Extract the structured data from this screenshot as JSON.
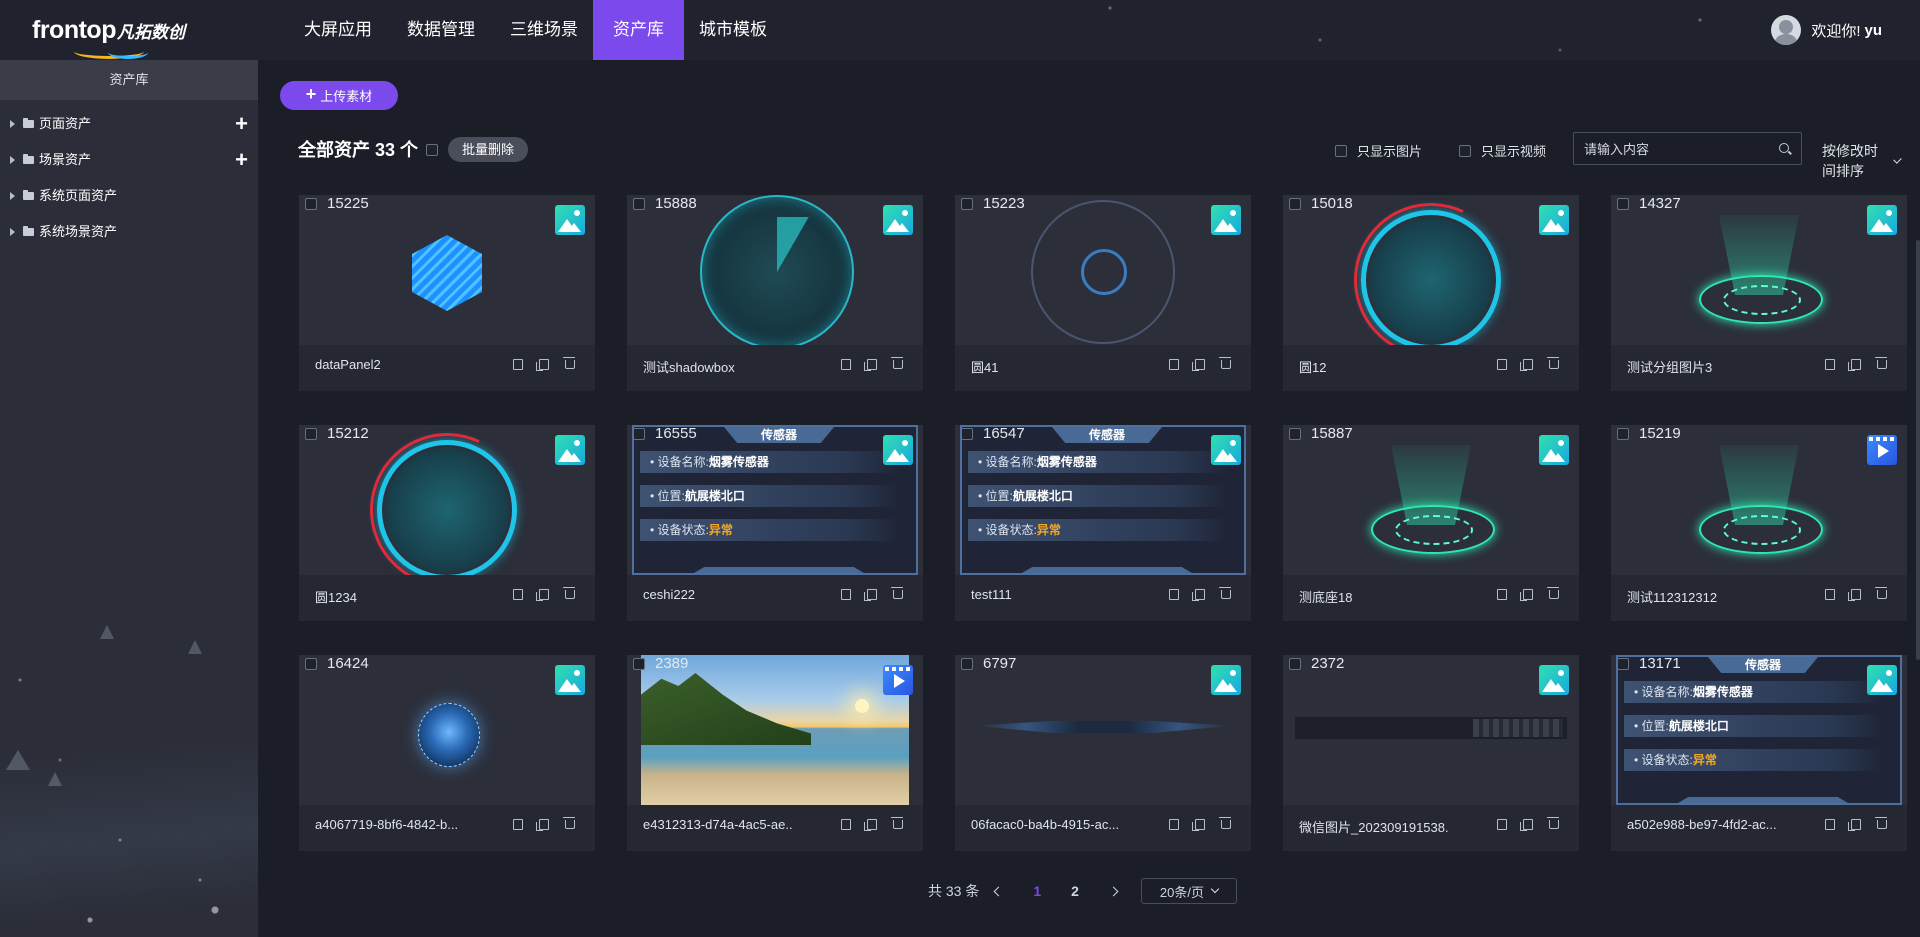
{
  "brand": {
    "name_en": "frontop",
    "name_cn": "凡拓数创"
  },
  "nav": {
    "items": [
      {
        "label": "大屏应用",
        "active": false
      },
      {
        "label": "数据管理",
        "active": false
      },
      {
        "label": "三维场景",
        "active": false
      },
      {
        "label": "资产库",
        "active": true
      },
      {
        "label": "城市模板",
        "active": false
      }
    ]
  },
  "user": {
    "greeting": "欢迎你!",
    "name": "yu"
  },
  "sidebar": {
    "title": "资产库",
    "items": [
      {
        "label": "页面资产",
        "has_add": true
      },
      {
        "label": "场景资产",
        "has_add": true
      },
      {
        "label": "系统页面资产",
        "has_add": false
      },
      {
        "label": "系统场景资产",
        "has_add": false
      }
    ]
  },
  "toolbar": {
    "upload_label": "上传素材",
    "total_label": "全部资产 33 个",
    "batch_delete_label": "批量删除",
    "filter_images_label": "只显示图片",
    "filter_videos_label": "只显示视频",
    "search_placeholder": "请输入内容",
    "sort_label": "按修改时间排序"
  },
  "sensor_text": {
    "header": "传感器",
    "name_label": "设备名称:",
    "name_value": "烟雾传感器",
    "location_label": "位置:",
    "location_value": "航展楼北口",
    "status_label": "设备状态:",
    "status_value": "异常"
  },
  "assets": [
    {
      "id": "15225",
      "name": "dataPanel2",
      "type": "image",
      "thumb": "hex"
    },
    {
      "id": "15888",
      "name": "测试shadowbox",
      "type": "image",
      "thumb": "radar"
    },
    {
      "id": "15223",
      "name": "圆41",
      "type": "image",
      "thumb": "ring-gray"
    },
    {
      "id": "15018",
      "name": "圆12",
      "type": "image",
      "thumb": "ring-cyan"
    },
    {
      "id": "14327",
      "name": "测试分组图片3",
      "type": "image",
      "thumb": "holo"
    },
    {
      "id": "15212",
      "name": "圆1234",
      "type": "image",
      "thumb": "ring-cyan"
    },
    {
      "id": "16555",
      "name": "ceshi222",
      "type": "image",
      "thumb": "sensor"
    },
    {
      "id": "16547",
      "name": "test111",
      "type": "image",
      "thumb": "sensor"
    },
    {
      "id": "15887",
      "name": "测底座18",
      "type": "image",
      "thumb": "holo"
    },
    {
      "id": "15219",
      "name": "测试112312312",
      "type": "video",
      "thumb": "holo"
    },
    {
      "id": "16424",
      "name": "a4067719-8bf6-4842-b...",
      "type": "image",
      "thumb": "orb"
    },
    {
      "id": "2389",
      "name": "e4312313-d74a-4ac5-ae...",
      "type": "video",
      "thumb": "beach"
    },
    {
      "id": "6797",
      "name": "06facac0-ba4b-4915-ac...",
      "type": "image",
      "thumb": "bar"
    },
    {
      "id": "2372",
      "name": "微信图片_202309191538...",
      "type": "image",
      "thumb": "wx"
    },
    {
      "id": "13171",
      "name": "a502e988-be97-4fd2-ac...",
      "type": "image",
      "thumb": "sensor"
    }
  ],
  "pagination": {
    "total_label": "共 33 条",
    "pages": [
      "1",
      "2"
    ],
    "current_page": "1",
    "page_size_label": "20条/页"
  },
  "colors": {
    "accent": "#7b49ec",
    "warning": "#f5a623"
  }
}
